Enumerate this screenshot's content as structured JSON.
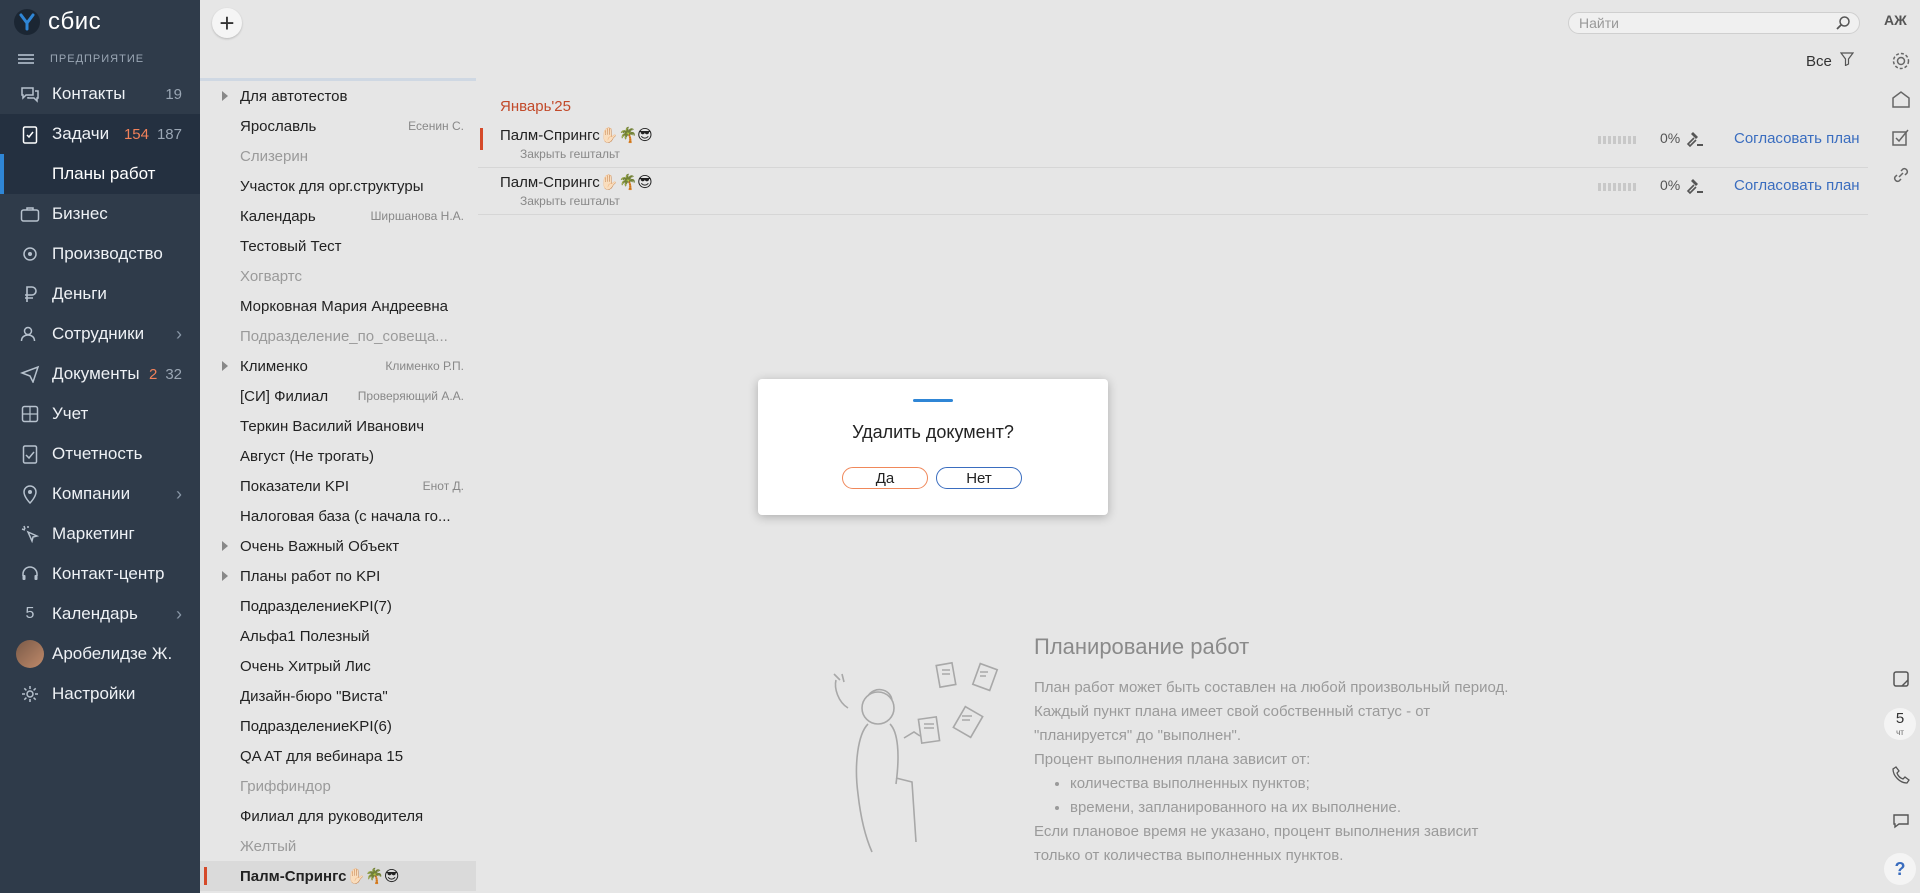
{
  "app": {
    "logo_text": "сбис",
    "org_label": "ПРЕДПРИЯТИЕ"
  },
  "nav": {
    "contacts": {
      "label": "Контакты",
      "count": "19"
    },
    "tasks": {
      "label": "Задачи",
      "count_new": "154",
      "count_total": "187"
    },
    "work_plans": {
      "label": "Планы работ"
    },
    "business": {
      "label": "Бизнес"
    },
    "production": {
      "label": "Производство"
    },
    "money": {
      "label": "Деньги"
    },
    "staff": {
      "label": "Сотрудники"
    },
    "documents": {
      "label": "Документы",
      "count_new": "2",
      "count_total": "32"
    },
    "accounting": {
      "label": "Учет"
    },
    "reporting": {
      "label": "Отчетность"
    },
    "companies": {
      "label": "Компании"
    },
    "marketing": {
      "label": "Маркетинг"
    },
    "contact_center": {
      "label": "Контакт-центр"
    },
    "calendar": {
      "label": "Календарь",
      "day": "5"
    },
    "user": {
      "label": "Аробелидзе Ж."
    },
    "settings": {
      "label": "Настройки"
    }
  },
  "topbar": {
    "search_placeholder": "Найти",
    "filter_label": "Все"
  },
  "rail": {
    "initials": "АЖ",
    "date_day": "5",
    "date_weekday": "чт",
    "help": "?"
  },
  "list": {
    "items": [
      {
        "label": "Для автотестов",
        "resp": "",
        "expandable": true,
        "muted": false
      },
      {
        "label": "Ярославль",
        "resp": "Есенин С.",
        "expandable": false,
        "muted": false
      },
      {
        "label": "Слизерин",
        "resp": "",
        "expandable": false,
        "muted": true
      },
      {
        "label": "Участок для орг.структуры",
        "resp": "",
        "expandable": false,
        "muted": false
      },
      {
        "label": "Календарь",
        "resp": "Ширшанова Н.А.",
        "expandable": false,
        "muted": false
      },
      {
        "label": "Тестовый Тест",
        "resp": "",
        "expandable": false,
        "muted": false
      },
      {
        "label": "Хогвартс",
        "resp": "",
        "expandable": false,
        "muted": true
      },
      {
        "label": "Морковная Мария Андреевна",
        "resp": "",
        "expandable": false,
        "muted": false
      },
      {
        "label": "Подразделение_по_совеща...",
        "resp": "",
        "expandable": false,
        "muted": true
      },
      {
        "label": "Клименко",
        "resp": "Клименко Р.П.",
        "expandable": true,
        "muted": false
      },
      {
        "label": "[СИ] Филиал",
        "resp": "Проверяющий А.А.",
        "expandable": false,
        "muted": false
      },
      {
        "label": "Теркин Василий Иванович",
        "resp": "",
        "expandable": false,
        "muted": false
      },
      {
        "label": "Август (Не трогать)",
        "resp": "",
        "expandable": false,
        "muted": false
      },
      {
        "label": "Показатели KPI",
        "resp": "Енот Д.",
        "expandable": false,
        "muted": false
      },
      {
        "label": "Налоговая база (с начала го...",
        "resp": "",
        "expandable": false,
        "muted": false
      },
      {
        "label": "Очень Важный Объект",
        "resp": "",
        "expandable": true,
        "muted": false
      },
      {
        "label": "Планы работ по KPI",
        "resp": "",
        "expandable": true,
        "muted": false
      },
      {
        "label": "ПодразделениеKPI(7)",
        "resp": "",
        "expandable": false,
        "muted": false
      },
      {
        "label": "Альфа1 Полезный",
        "resp": "",
        "expandable": false,
        "muted": false
      },
      {
        "label": "Очень Хитрый Лис",
        "resp": "",
        "expandable": false,
        "muted": false
      },
      {
        "label": "Дизайн-бюро \"Виста\"",
        "resp": "",
        "expandable": false,
        "muted": false
      },
      {
        "label": "ПодразделениеKPI(6)",
        "resp": "",
        "expandable": false,
        "muted": false
      },
      {
        "label": "QA AT для вебинара 15",
        "resp": "",
        "expandable": false,
        "muted": false
      },
      {
        "label": "Гриффиндор",
        "resp": "",
        "expandable": false,
        "muted": true
      },
      {
        "label": "Филиал для руководителя",
        "resp": "",
        "expandable": false,
        "muted": false
      },
      {
        "label": "Желтый",
        "resp": "",
        "expandable": false,
        "muted": true
      },
      {
        "label": "Палм-Спрингс✋🏻🌴😎",
        "resp": "",
        "expandable": false,
        "muted": false,
        "selected": true
      }
    ]
  },
  "main": {
    "month_header": "Январь'25",
    "plans": [
      {
        "title": "Палм-Спрингс✋🏻🌴😎",
        "subtitle": "Закрыть гештальт",
        "percent": "0%",
        "progress": 0,
        "action": "Согласовать план"
      },
      {
        "title": "Палм-Спрингс✋🏻🌴😎",
        "subtitle": "Закрыть гештальт",
        "percent": "0%",
        "progress": 0,
        "action": "Согласовать план"
      }
    ],
    "empty": {
      "title": "Планирование работ",
      "p1": "План работ может быть составлен на любой произвольный период.",
      "p2": "Каждый пункт плана имеет свой собственный статус - от",
      "p3": "\"планируется\" до \"выполнен\".",
      "p4": "Процент выполнения плана зависит от:",
      "li1": "количества выполненных пунктов;",
      "li2": "времени, запланированного на их выполнение.",
      "p5": "Если плановое время не указано, процент выполнения зависит",
      "p6": "только от количества выполненных пунктов."
    }
  },
  "dialog": {
    "question": "Удалить документ?",
    "yes": "Да",
    "no": "Нет"
  },
  "colors": {
    "sidebar": "#2f3b4a",
    "accent_blue": "#2f86d6",
    "accent_red": "#d54a2a",
    "link": "#3a6dbf"
  }
}
